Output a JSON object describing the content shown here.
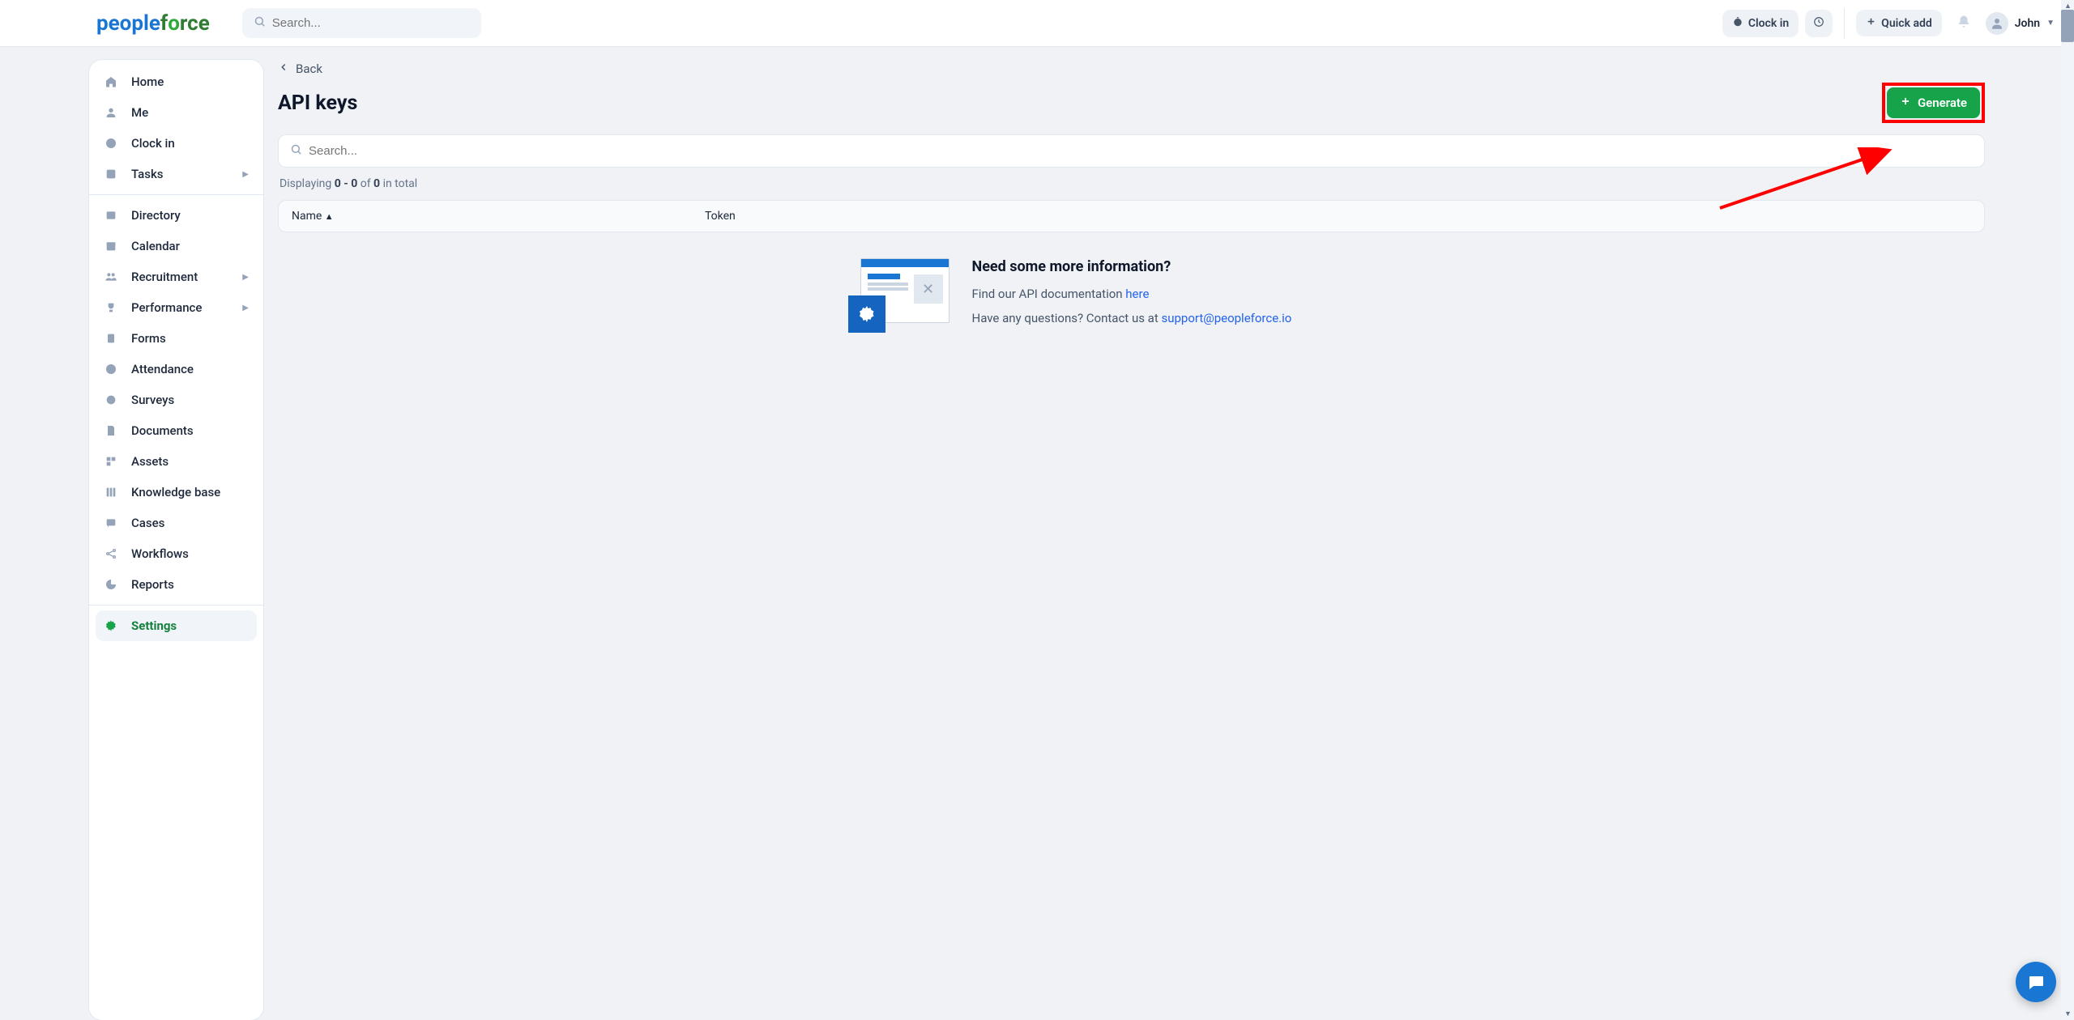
{
  "header": {
    "search_placeholder": "Search...",
    "clock_in": "Clock in",
    "quick_add": "Quick add",
    "user_name": "John"
  },
  "sidebar": {
    "items": [
      {
        "label": "Home"
      },
      {
        "label": "Me"
      },
      {
        "label": "Clock in"
      },
      {
        "label": "Tasks",
        "expandable": true
      },
      {
        "label": "Directory"
      },
      {
        "label": "Calendar"
      },
      {
        "label": "Recruitment",
        "expandable": true
      },
      {
        "label": "Performance",
        "expandable": true
      },
      {
        "label": "Forms"
      },
      {
        "label": "Attendance"
      },
      {
        "label": "Surveys"
      },
      {
        "label": "Documents"
      },
      {
        "label": "Assets"
      },
      {
        "label": "Knowledge base"
      },
      {
        "label": "Cases"
      },
      {
        "label": "Workflows"
      },
      {
        "label": "Reports"
      },
      {
        "label": "Settings",
        "active": true
      }
    ]
  },
  "page": {
    "back": "Back",
    "title": "API keys",
    "generate": "Generate",
    "search_placeholder": "Search...",
    "displaying_prefix": "Displaying ",
    "displaying_range": "0 - 0",
    "displaying_of": " of ",
    "displaying_total": "0",
    "displaying_suffix": " in total",
    "columns": {
      "name": "Name",
      "token": "Token"
    }
  },
  "info": {
    "heading": "Need some more information?",
    "doc_prefix": "Find our API documentation ",
    "doc_link": "here",
    "contact_prefix": "Have any questions? Contact us at ",
    "contact_email": "support@peopleforce.io"
  }
}
